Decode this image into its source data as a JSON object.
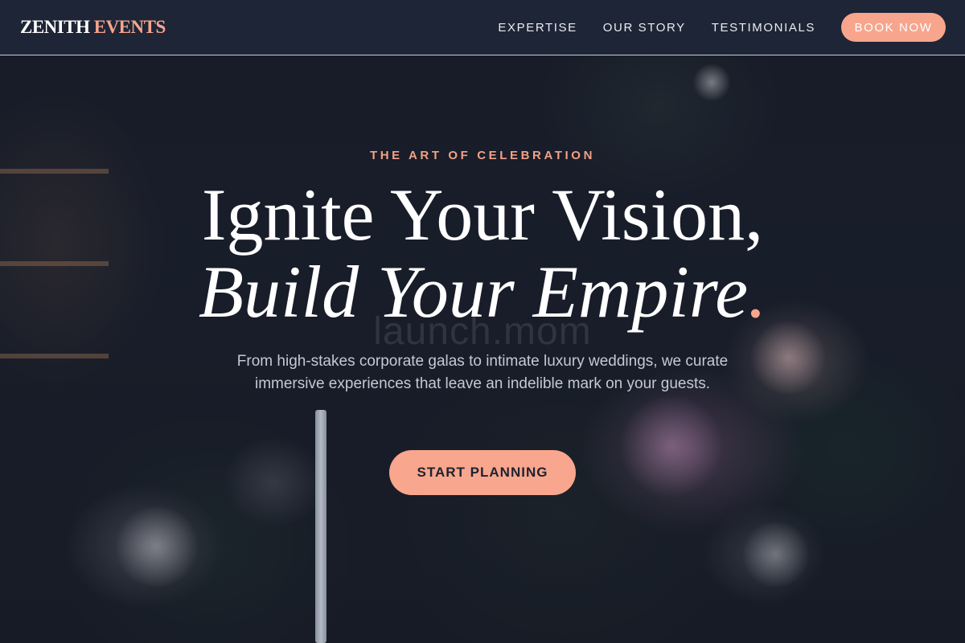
{
  "brand": {
    "name_part1": "ZENITH",
    "name_part2": "EVENTS",
    "accent_color": "#f7a58c"
  },
  "nav": {
    "links": [
      {
        "label": "EXPERTISE"
      },
      {
        "label": "OUR STORY"
      },
      {
        "label": "TESTIMONIALS"
      }
    ],
    "book_label": "BOOK NOW"
  },
  "hero": {
    "eyebrow": "THE ART OF CELEBRATION",
    "headline_line1": "Ignite Your Vision,",
    "headline_line2": "Build Your Empire",
    "headline_period": ".",
    "watermark": "launch.mom",
    "subtext": "From high-stakes corporate galas to intimate luxury weddings, we curate immersive experiences that leave an indelible mark on your guests.",
    "cta_label": "START PLANNING"
  },
  "colors": {
    "header_bg": "#1e2536",
    "accent": "#f7a58c",
    "text_primary": "#ffffff",
    "text_muted": "#c4c9d4"
  }
}
